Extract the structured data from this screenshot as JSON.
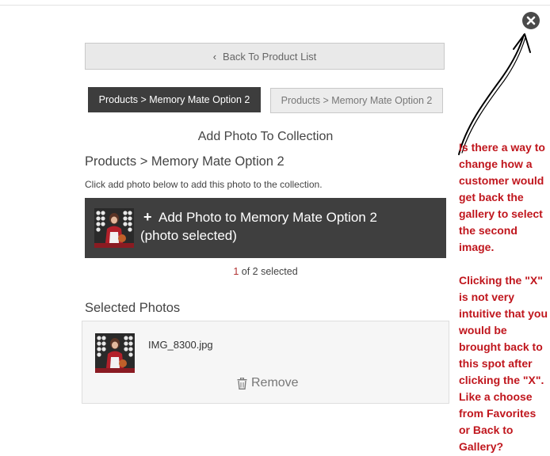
{
  "nav": {
    "back_label": "Back To Product List"
  },
  "breadcrumbs": [
    {
      "label": "Products > Memory Mate Option 2",
      "active": true
    },
    {
      "label": "Products > Memory Mate Option 2",
      "active": false
    }
  ],
  "main": {
    "section_title": "Add Photo To Collection",
    "subtitle": "Products > Memory Mate Option 2",
    "instruction": "Click add photo below to add this photo to the collection.",
    "add_button": {
      "line1": "Add Photo to Memory Mate Option 2",
      "line2": "(photo selected)"
    },
    "selection_count": "1",
    "selection_rest": " of 2 selected"
  },
  "selected": {
    "title": "Selected Photos",
    "items": [
      {
        "filename": "IMG_8300.jpg",
        "remove_label": "Remove"
      }
    ]
  },
  "annotation": {
    "paragraph1": "Is there a way to change how a customer would get back the gallery to select the second image.",
    "paragraph2": "Clicking the \"X\" is not very intuitive that you would be brought back to this spot after clicking the \"X\". Like a choose from Favorites or Back to Gallery?"
  },
  "colors": {
    "dark_button": "#3d3d3d",
    "annotation_red": "#c0161d",
    "count_highlight": "#b03030"
  },
  "icons": {
    "close": "close-circle-icon",
    "back": "chevron-left-icon",
    "add": "plus-icon",
    "remove": "trash-icon"
  }
}
